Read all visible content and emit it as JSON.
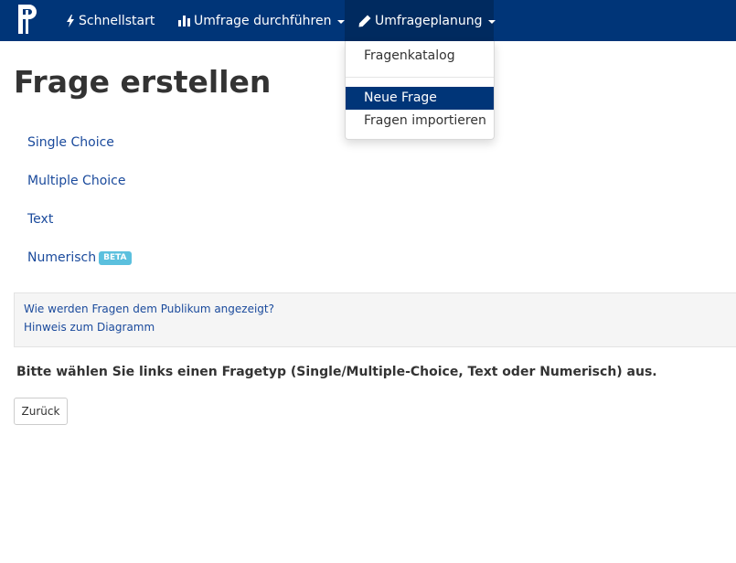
{
  "navbar": {
    "logo_icon": "pingo-logo-icon",
    "quickstart_label": "Schnellstart",
    "quickstart_icon": "bolt-icon",
    "run_survey_label": "Umfrage durchführen",
    "run_survey_icon": "bar-chart-icon",
    "planning_label": "Umfrageplanung",
    "planning_icon": "pencil-icon",
    "background_color": "#003578"
  },
  "dropdown": {
    "items": [
      {
        "label": "Fragenkatalog"
      },
      {
        "label": "Neue Frage",
        "active": true
      },
      {
        "label": "Fragen importieren"
      }
    ],
    "active_color": "#003578"
  },
  "main": {
    "title": "Frage erstellen",
    "question_types": [
      {
        "label": "Single Choice"
      },
      {
        "label": "Multiple Choice"
      },
      {
        "label": "Text"
      },
      {
        "label": "Numerisch",
        "badge": "BETA"
      }
    ],
    "info_links": [
      "Wie werden Fragen dem Publikum angezeigt?",
      "Hinweis zum Diagramm"
    ],
    "instruction": "Bitte wählen Sie links einen Fragetyp (Single/Multiple-Choice, Text oder Numerisch) aus.",
    "back_label": "Zurück",
    "link_color": "#1a4a9c",
    "badge_color": "#5bc0de"
  }
}
